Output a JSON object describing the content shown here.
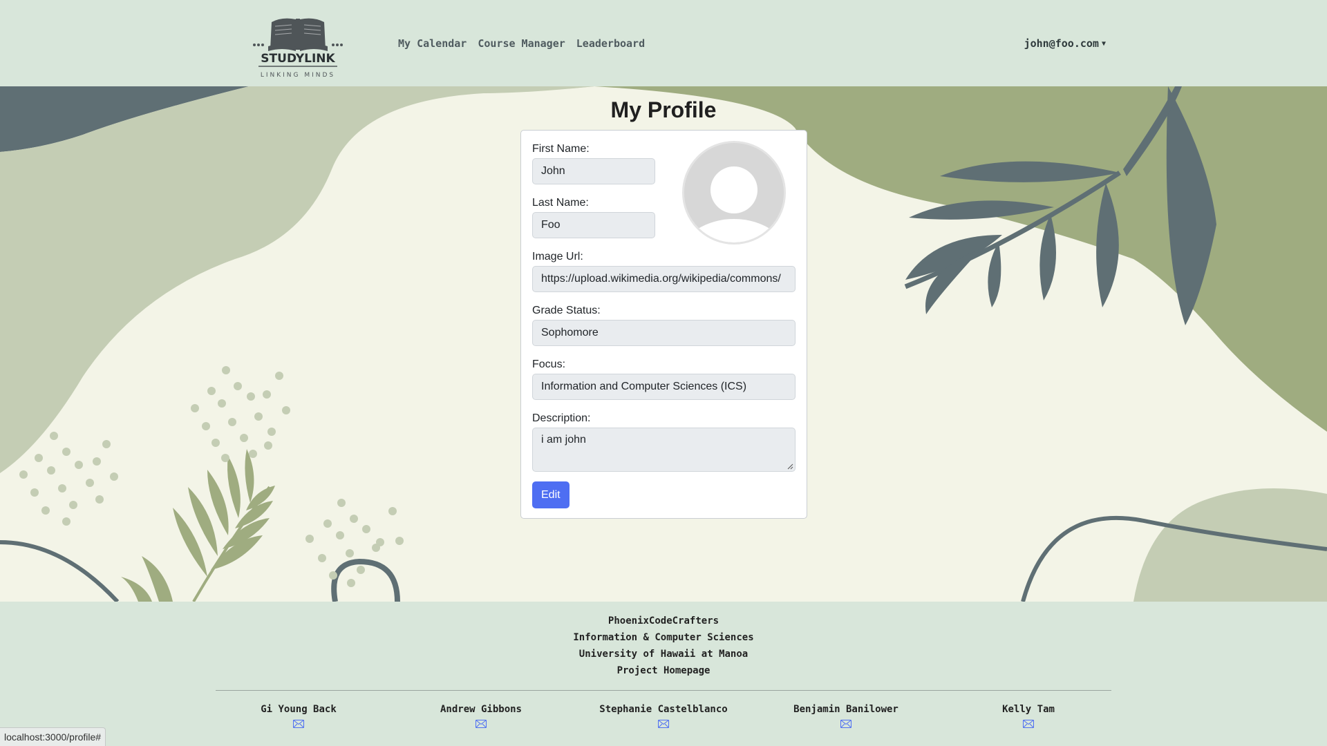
{
  "logo": {
    "name": "STUDYLINK",
    "tagline": "LINKING MINDS",
    "icon": "open-book-icon"
  },
  "nav": {
    "links": [
      "My Calendar",
      "Course Manager",
      "Leaderboard"
    ],
    "user": "john@foo.com"
  },
  "page": {
    "title": "My Profile"
  },
  "profile": {
    "first_name_label": "First Name:",
    "first_name": "John",
    "last_name_label": "Last Name:",
    "last_name": "Foo",
    "image_url_label": "Image Url:",
    "image_url": "https://upload.wikimedia.org/wikipedia/commons/",
    "grade_label": "Grade Status:",
    "grade": "Sophomore",
    "focus_label": "Focus:",
    "focus": "Information and Computer Sciences (ICS)",
    "description_label": "Description:",
    "description": "i am john",
    "edit_label": "Edit",
    "avatar_icon": "user-avatar-placeholder-icon"
  },
  "footer": {
    "lines": [
      "PhoenixCodeCrafters",
      "Information & Computer Sciences",
      "University of Hawaii at Manoa",
      "Project Homepage"
    ],
    "team": [
      "Gi Young Back",
      "Andrew Gibbons",
      "Stephanie Castelblanco",
      "Benjamin Banilower",
      "Kelly Tam"
    ]
  },
  "status_bar": {
    "url": "localhost:3000/profile#"
  },
  "colors": {
    "navbar_bg": "#d8e6da",
    "accent_button": "#4e6ef2",
    "dark_slate": "#5a6b71",
    "sage": "#9fac80",
    "light_sage": "#c4cdb4"
  }
}
